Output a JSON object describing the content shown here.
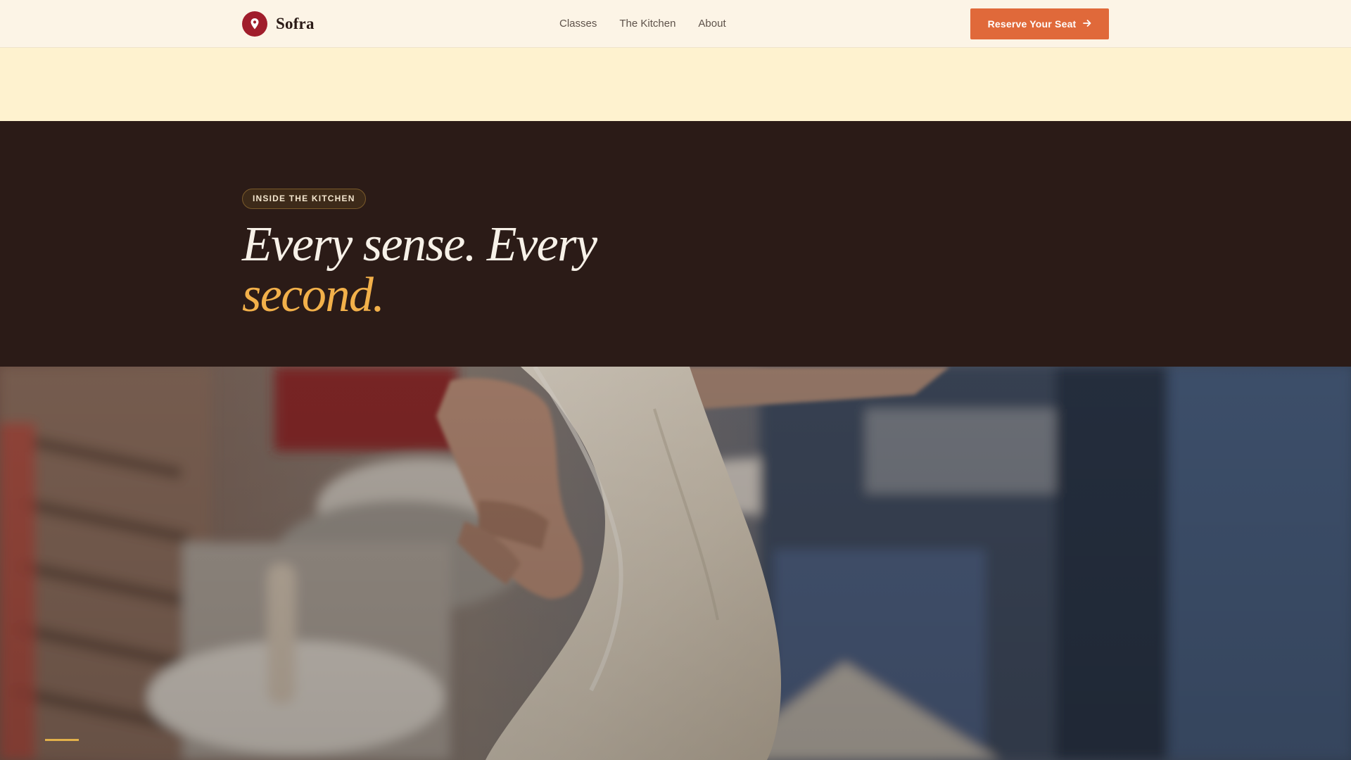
{
  "brand": {
    "name": "Sofra",
    "logo_icon": "map-pin-icon",
    "logo_color": "#a01d2b"
  },
  "nav": [
    {
      "label": "Classes"
    },
    {
      "label": "The Kitchen"
    },
    {
      "label": "About"
    }
  ],
  "cta": {
    "label": "Reserve Your Seat",
    "icon": "arrow-right-icon",
    "color": "#e0693a"
  },
  "section": {
    "eyebrow": "INSIDE THE KITCHEN",
    "headline_line1": "Every sense. Every",
    "headline_accent": "second.",
    "accent_color": "#f2b04a",
    "background": "#2b1b17"
  },
  "hero_image": {
    "subject": "cook-stretching-dough-photo",
    "slide_indicator_color": "#e2b04a"
  }
}
